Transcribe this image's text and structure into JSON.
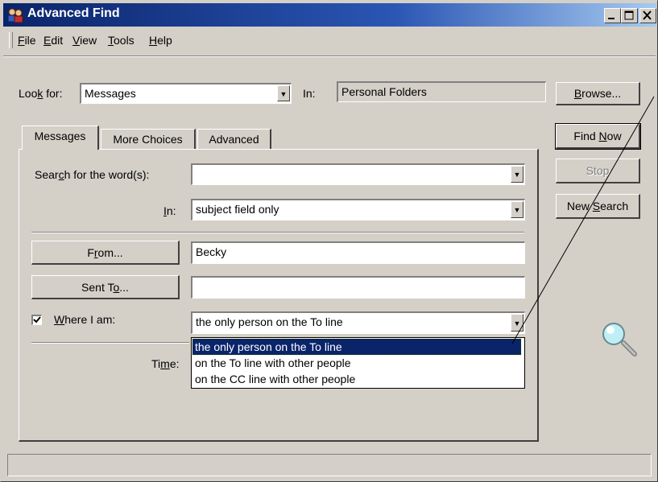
{
  "window": {
    "title": "Advanced Find",
    "icon": "find-people-icon",
    "controls": [
      "minimize-icon",
      "maximize-icon",
      "close-icon"
    ]
  },
  "menu": [
    {
      "label": "File",
      "key": "F"
    },
    {
      "label": "Edit",
      "key": "E"
    },
    {
      "label": "View",
      "key": "V"
    },
    {
      "label": "Tools",
      "key": "T"
    },
    {
      "label": "Help",
      "key": "H"
    }
  ],
  "look_for": {
    "label_pre": "Loo",
    "label_key": "k",
    "label_post": " for:",
    "value": "Messages"
  },
  "in_folder": {
    "label": "In:",
    "value": "Personal Folders"
  },
  "buttons": {
    "browse": {
      "pre": "",
      "key": "B",
      "post": "rowse..."
    },
    "find_now": {
      "pre": "Find ",
      "key": "N",
      "post": "ow"
    },
    "stop": {
      "label": "Stop"
    },
    "new_search": {
      "pre": "New ",
      "key": "S",
      "post": "earch"
    }
  },
  "tabs": [
    {
      "label": "Messages",
      "active": true
    },
    {
      "label": "More Choices",
      "active": false
    },
    {
      "label": "Advanced",
      "active": false
    }
  ],
  "search_words": {
    "pre": "Sear",
    "key": "c",
    "post": "h for the word(s):",
    "value": ""
  },
  "search_in": {
    "key": "I",
    "post": "n:",
    "value": "subject field only"
  },
  "from": {
    "pre": "F",
    "key": "r",
    "post": "om...",
    "value": "Becky"
  },
  "sent_to": {
    "pre": "Sent T",
    "key": "o",
    "post": "...",
    "value": ""
  },
  "where_i_am": {
    "checked": true,
    "key": "W",
    "post": "here I am:",
    "value": "the only person on the To line",
    "options": [
      "the only person on the To line",
      "on the To line with other people",
      "on the CC line with other people"
    ],
    "selected_index": 0
  },
  "time": {
    "pre": "Ti",
    "key": "m",
    "post": "e:"
  },
  "search_animation_icon": "magnifying-glass-icon",
  "status_text": ""
}
